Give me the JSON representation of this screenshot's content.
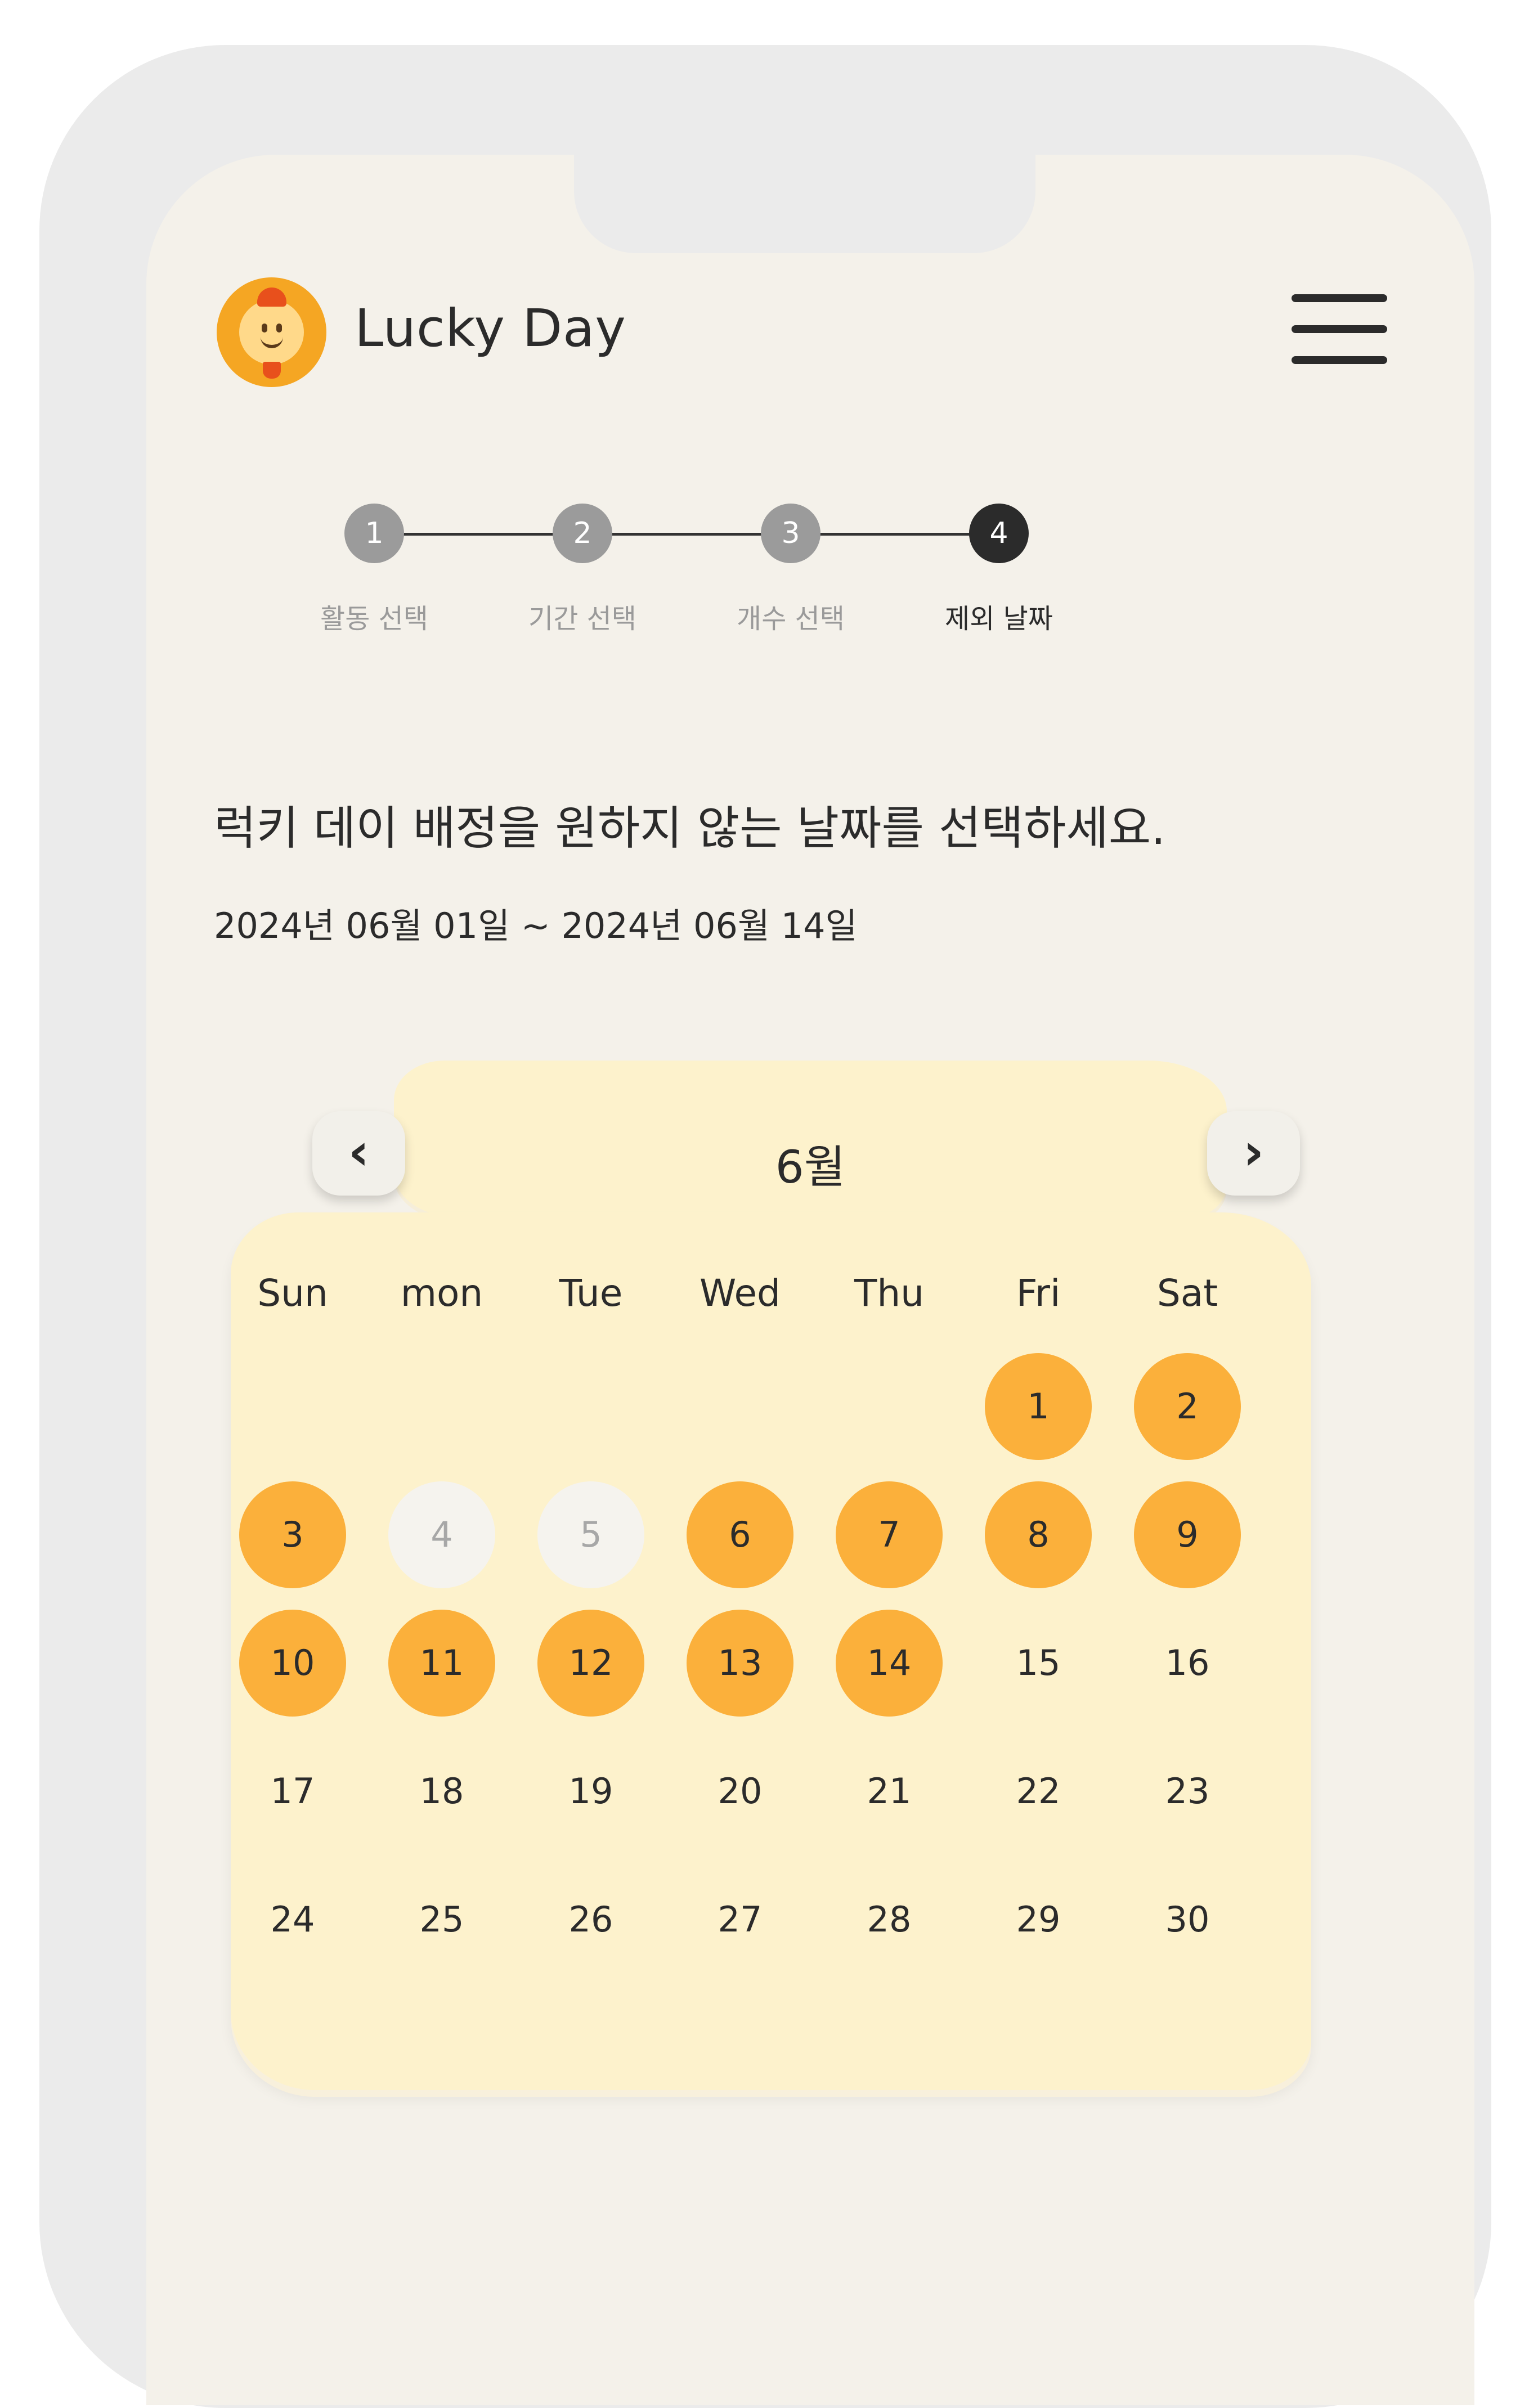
{
  "header": {
    "app_name": "Lucky Day",
    "logo_icon": "mascot-logo-icon",
    "menu_icon": "hamburger-menu-icon"
  },
  "steps": [
    {
      "number": "1",
      "label": "활동 선택",
      "state": "done"
    },
    {
      "number": "2",
      "label": "기간 선택",
      "state": "done"
    },
    {
      "number": "3",
      "label": "개수 선택",
      "state": "done"
    },
    {
      "number": "4",
      "label": "제외 날짜",
      "state": "active"
    }
  ],
  "content": {
    "headline": "럭키 데이 배정을 원하지 않는 날짜를 선택하세요.",
    "range": "2024년 06월 01일 ~ 2024년 06월 14일"
  },
  "calendar": {
    "month": "6월",
    "prev_icon": "chevron-left-icon",
    "next_icon": "chevron-right-icon",
    "weekdays": [
      "Sun",
      "mon",
      "Tue",
      "Wed",
      "Thu",
      "Fri",
      "Sat"
    ],
    "days": [
      {
        "label": "1",
        "state": "selected"
      },
      {
        "label": "2",
        "state": "selected"
      },
      {
        "label": "3",
        "state": "selected"
      },
      {
        "label": "4",
        "state": "excluded"
      },
      {
        "label": "5",
        "state": "excluded"
      },
      {
        "label": "6",
        "state": "selected"
      },
      {
        "label": "7",
        "state": "selected"
      },
      {
        "label": "8",
        "state": "selected"
      },
      {
        "label": "9",
        "state": "selected"
      },
      {
        "label": "10",
        "state": "selected"
      },
      {
        "label": "11",
        "state": "selected"
      },
      {
        "label": "12",
        "state": "selected"
      },
      {
        "label": "13",
        "state": "selected"
      },
      {
        "label": "14",
        "state": "selected"
      },
      {
        "label": "15",
        "state": "normal"
      },
      {
        "label": "16",
        "state": "normal"
      },
      {
        "label": "17",
        "state": "normal"
      },
      {
        "label": "18",
        "state": "normal"
      },
      {
        "label": "19",
        "state": "normal"
      },
      {
        "label": "20",
        "state": "normal"
      },
      {
        "label": "21",
        "state": "normal"
      },
      {
        "label": "22",
        "state": "normal"
      },
      {
        "label": "23",
        "state": "normal"
      },
      {
        "label": "24",
        "state": "normal"
      },
      {
        "label": "25",
        "state": "normal"
      },
      {
        "label": "26",
        "state": "normal"
      },
      {
        "label": "27",
        "state": "normal"
      },
      {
        "label": "28",
        "state": "normal"
      },
      {
        "label": "29",
        "state": "normal"
      },
      {
        "label": "30",
        "state": "normal"
      }
    ]
  },
  "colors": {
    "selected": "#fbb03b",
    "excluded": "#f5f3ee",
    "panel": "#fdf2cc",
    "text": "#2b2b2b"
  }
}
